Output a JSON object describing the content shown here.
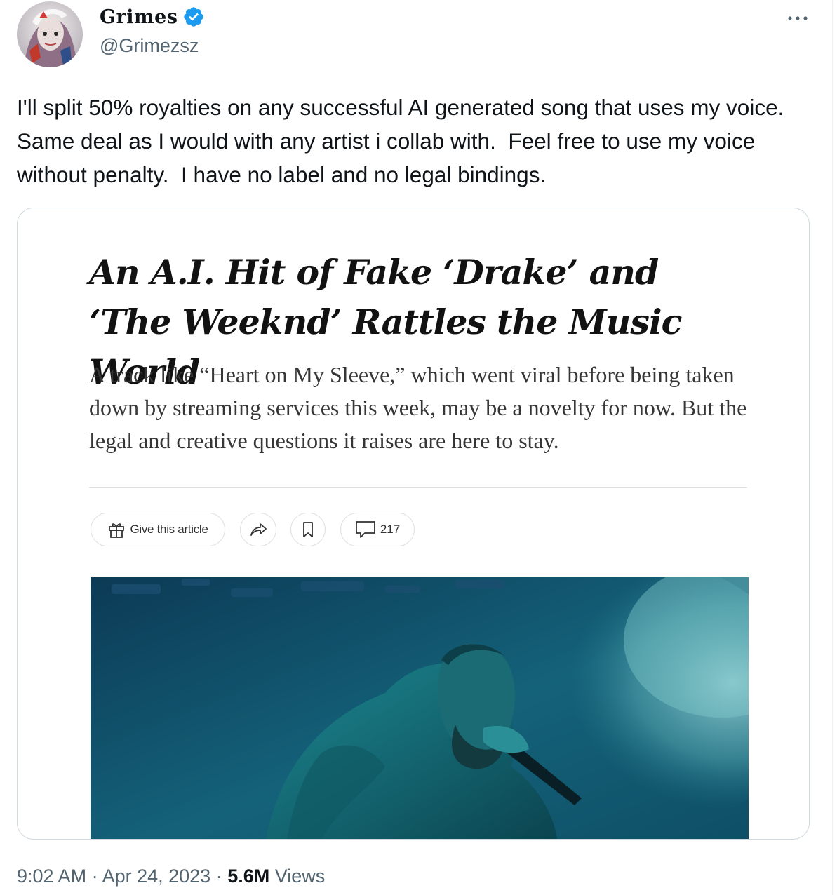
{
  "author": {
    "display_name": "Grimes",
    "handle": "@Grimezsz",
    "verified": true,
    "badge_color": "#1d9bf0"
  },
  "tweet": {
    "text": "I'll split 50% royalties on any successful AI generated song that uses my voice.  Same deal as I would with any artist i collab with.  Feel free to use my voice without penalty.  I have no label and no legal bindings."
  },
  "article": {
    "headline": "An A.I. Hit of Fake ‘Drake’ and ‘The Weeknd’ Rattles the Music World",
    "summary": "A track like “Heart on My Sleeve,” which went viral before being taken down by streaming services this week, may be a novelty for now. But the legal and creative questions it raises are here to stay.",
    "gift_label": "Give this article",
    "comment_count": "217",
    "icons": [
      "gift-icon",
      "share-icon",
      "bookmark-icon",
      "comment-icon"
    ]
  },
  "meta": {
    "time": "9:02 AM",
    "separator": " · ",
    "date": "Apr 24, 2023",
    "views_count": "5.6M",
    "views_label": "Views"
  },
  "menu": {
    "icon": "more-icon"
  },
  "colors": {
    "text": "#0f1419",
    "secondary": "#536471",
    "border": "#cfd9de",
    "photo_tint": "#1f7a86"
  }
}
